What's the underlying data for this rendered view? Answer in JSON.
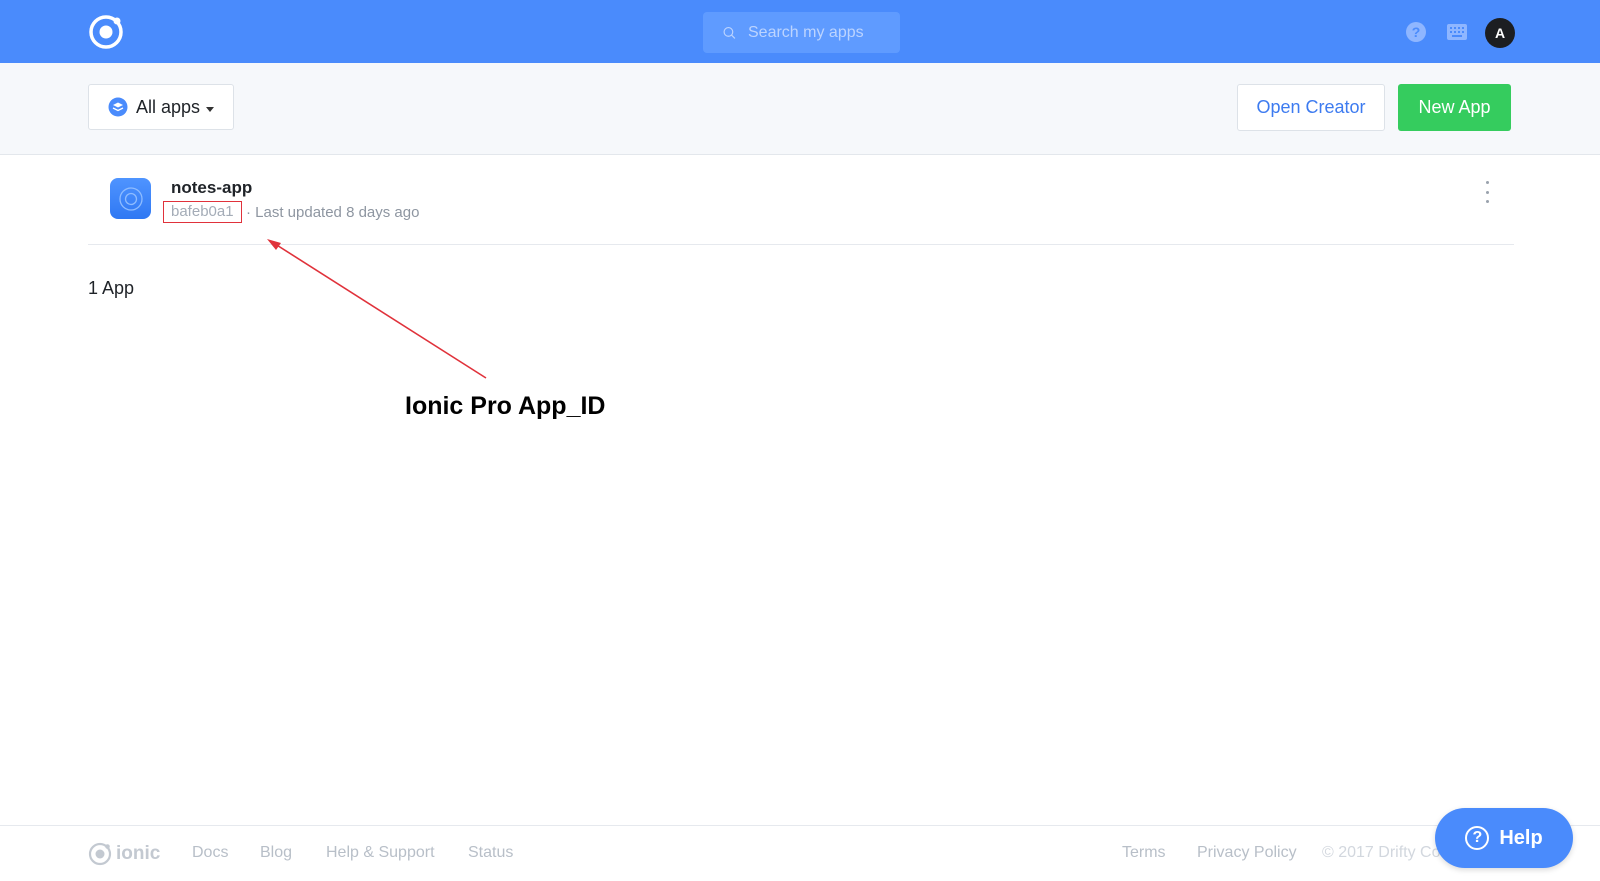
{
  "header": {
    "search_placeholder": "Search my apps",
    "avatar_initial": "A"
  },
  "subheader": {
    "filter_label": "All apps",
    "open_creator_label": "Open Creator",
    "new_app_label": "New App"
  },
  "apps": [
    {
      "name": "notes-app",
      "id": "bafeb0a1",
      "meta": "· Last updated 8 days ago"
    }
  ],
  "app_count": "1 App",
  "annotation": {
    "label": "Ionic Pro App_ID"
  },
  "footer": {
    "brand": "ionic",
    "links": [
      "Docs",
      "Blog",
      "Help & Support",
      "Status"
    ],
    "right_links": [
      "Terms",
      "Privacy Policy"
    ],
    "copyright": "© 2017 Drifty Co"
  },
  "help_button": {
    "label": "Help"
  },
  "colors": {
    "brand_blue": "#4a8bfc",
    "new_app_green": "#35cc5e",
    "annotation_red": "#e0323b"
  }
}
